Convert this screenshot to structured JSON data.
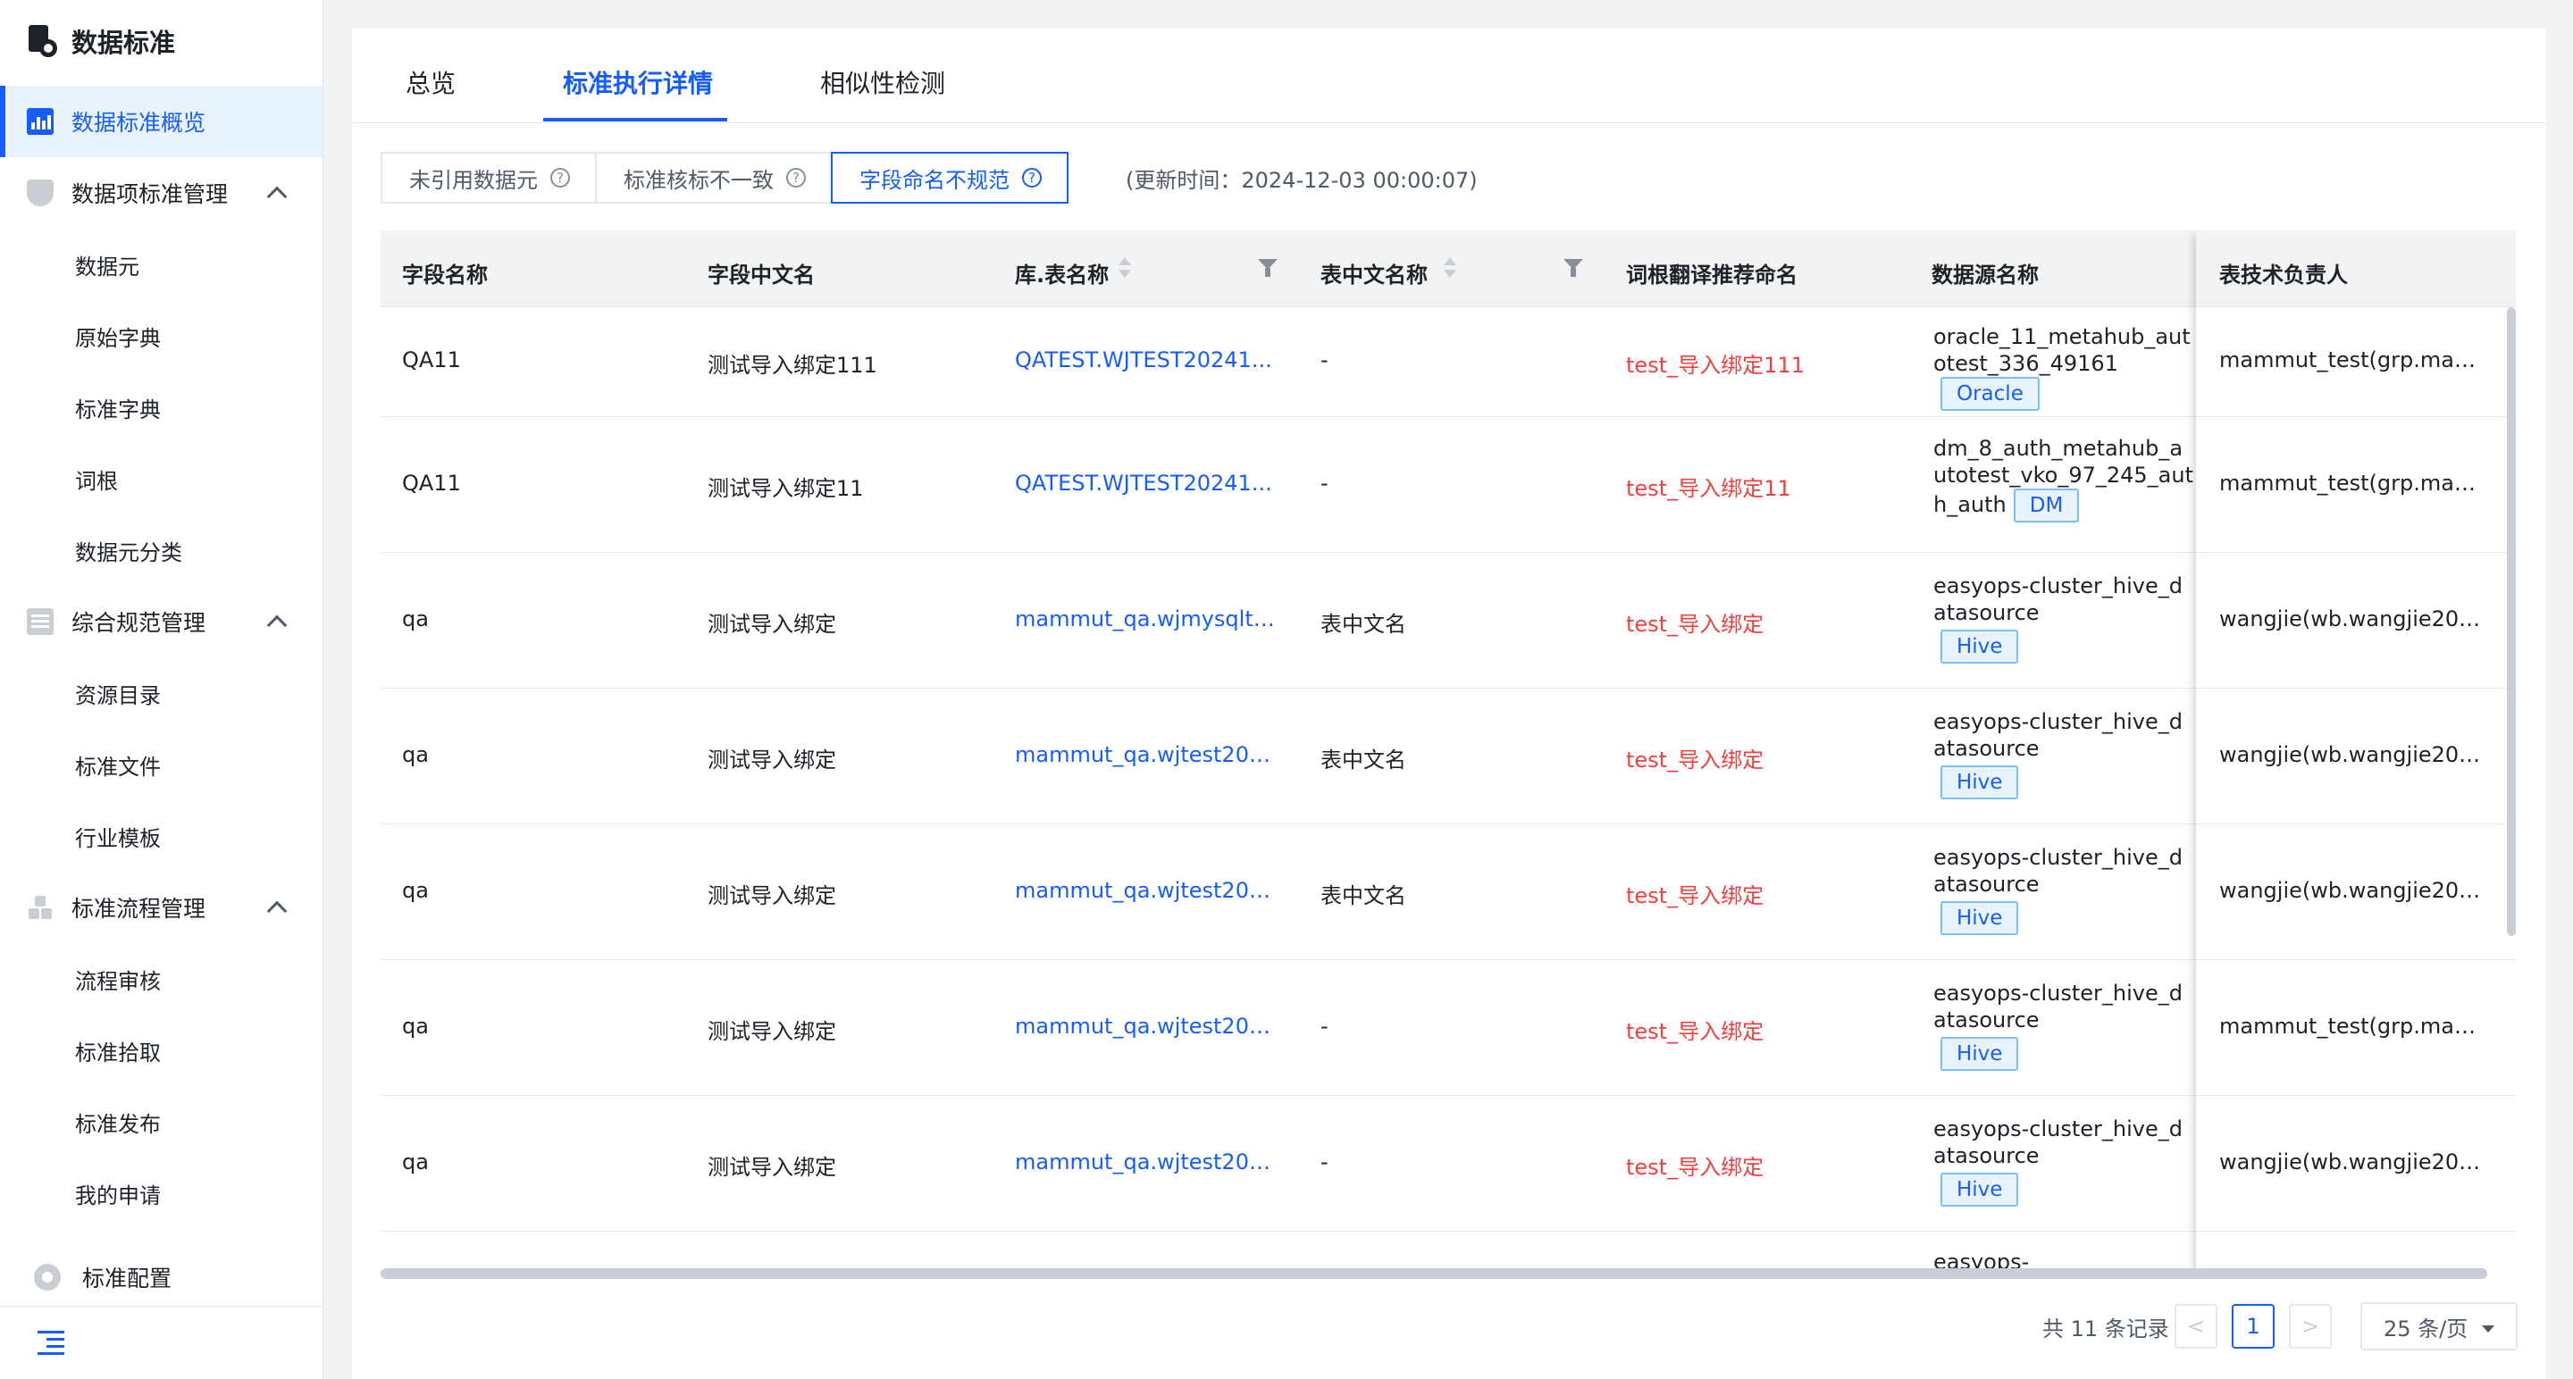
{
  "app_title": "数据标准",
  "nav": {
    "overview": "数据标准概览",
    "item_mgmt": "数据项标准管理",
    "item_children": [
      "数据元",
      "原始字典",
      "标准字典",
      "词根",
      "数据元分类"
    ],
    "spec_mgmt": "综合规范管理",
    "spec_children": [
      "资源目录",
      "标准文件",
      "行业模板"
    ],
    "flow_mgmt": "标准流程管理",
    "flow_children": [
      "流程审核",
      "标准拾取",
      "标准发布",
      "我的申请"
    ],
    "config": "标准配置"
  },
  "tabs": [
    "总览",
    "标准执行详情",
    "相似性检测"
  ],
  "filters": [
    "未引用数据元",
    "标准核标不一致",
    "字段命名不规范"
  ],
  "filter_help_icon": "?",
  "update_time": "(更新时间：2024-12-03 00:00:07)",
  "columns": [
    "字段名称",
    "字段中文名",
    "库.表名称",
    "表中文名称",
    "词根翻译推荐命名",
    "数据源名称",
    "表技术负责人"
  ],
  "rows": [
    {
      "field": "QA11",
      "cn": "测试导入绑定111",
      "table": "QATEST.WJTEST20241...",
      "table_cn": "-",
      "rec": "test_导入绑定111",
      "ds": "oracle_11_metahub_autotest_336_49161",
      "ds_tag": "Oracle",
      "owner": "mammut_test(grp.mam..."
    },
    {
      "field": "QA11",
      "cn": "测试导入绑定11",
      "table": "QATEST.WJTEST20241...",
      "table_cn": "-",
      "rec": "test_导入绑定11",
      "ds": "dm_8_auth_metahub_autotest_vko_97_245_auth_auth",
      "ds_tag": "DM",
      "owner": "mammut_test(grp.mam..."
    },
    {
      "field": "qa",
      "cn": "测试导入绑定",
      "table": "mammut_qa.wjmysqltes...",
      "table_cn": "表中文名",
      "rec": "test_导入绑定",
      "ds": "easyops-cluster_hive_datasource",
      "ds_tag": "Hive",
      "owner": "wangjie(wb.wangjie20@..."
    },
    {
      "field": "qa",
      "cn": "测试导入绑定",
      "table": "mammut_qa.wjtest2024...",
      "table_cn": "表中文名",
      "rec": "test_导入绑定",
      "ds": "easyops-cluster_hive_datasource",
      "ds_tag": "Hive",
      "owner": "wangjie(wb.wangjie20@..."
    },
    {
      "field": "qa",
      "cn": "测试导入绑定",
      "table": "mammut_qa.wjtest2024...",
      "table_cn": "表中文名",
      "rec": "test_导入绑定",
      "ds": "easyops-cluster_hive_datasource",
      "ds_tag": "Hive",
      "owner": "wangjie(wb.wangjie20@..."
    },
    {
      "field": "qa",
      "cn": "测试导入绑定",
      "table": "mammut_qa.wjtest2024...",
      "table_cn": "-",
      "rec": "test_导入绑定",
      "ds": "easyops-cluster_hive_datasource",
      "ds_tag": "Hive",
      "owner": "mammut_test(grp.mam..."
    },
    {
      "field": "qa",
      "cn": "测试导入绑定",
      "table": "mammut_qa.wjtest2024...",
      "table_cn": "-",
      "rec": "test_导入绑定",
      "ds": "easyops-cluster_hive_datasource",
      "ds_tag": "Hive",
      "owner": "wangjie(wb.wangjie20@..."
    }
  ],
  "partial_row_ds": "easyops-",
  "pagination": {
    "total": "共 11 条记录",
    "prev": "<",
    "page": "1",
    "next": ">",
    "size": "25 条/页"
  }
}
